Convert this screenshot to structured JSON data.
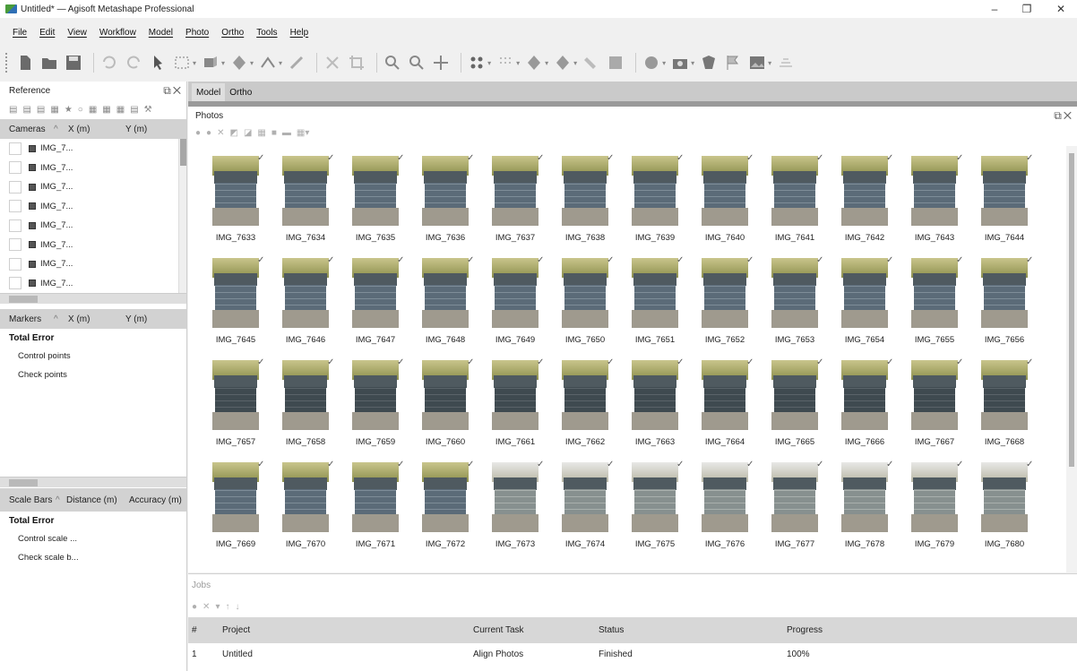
{
  "window": {
    "title": "Untitled* — Agisoft Metashape Professional",
    "buttons": [
      "–",
      "❐",
      "✕"
    ]
  },
  "menu": [
    "File",
    "Edit",
    "View",
    "Workflow",
    "Model",
    "Photo",
    "Ortho",
    "Tools",
    "Help"
  ],
  "toolbar": {
    "icons": [
      "new-icon",
      "open-icon",
      "save-icon",
      "undo-icon",
      "redo-icon",
      "navigation-icon",
      "rectangle-selection-icon",
      "model-icon",
      "dense-cloud-icon",
      "measure-icon",
      "ruler-icon",
      "delete-icon",
      "crop-icon",
      "zoom-in-icon",
      "zoom-out-icon",
      "move-icon",
      "point-cloud-icon",
      "grid-icon",
      "shaded-icon",
      "texture-icon",
      "show-icon",
      "dem-icon",
      "globe-icon",
      "camera-icon",
      "markers-icon",
      "flag-icon",
      "image-icon",
      "align-icon"
    ]
  },
  "reference": {
    "title": "Reference",
    "cameras_header": {
      "col1": "Cameras",
      "col2": "X (m)",
      "col3": "Y (m)"
    },
    "cameras": [
      "IMG_7...",
      "IMG_7...",
      "IMG_7...",
      "IMG_7...",
      "IMG_7...",
      "IMG_7...",
      "IMG_7...",
      "IMG_7..."
    ],
    "markers_header": {
      "col1": "Markers",
      "col2": "X (m)",
      "col3": "Y (m)"
    },
    "markers_total": "Total Error",
    "markers_items": [
      "Control points",
      "Check points"
    ],
    "scalebars_header": {
      "col1": "Scale Bars",
      "col2": "Distance (m)",
      "col3": "Accuracy (m)"
    },
    "scalebars_total": "Total Error",
    "scalebars_items": [
      "Control scale ...",
      "Check scale b..."
    ]
  },
  "tabs": [
    "Model",
    "Ortho"
  ],
  "photos": {
    "title": "Photos",
    "items": [
      "IMG_7633",
      "IMG_7634",
      "IMG_7635",
      "IMG_7636",
      "IMG_7637",
      "IMG_7638",
      "IMG_7639",
      "IMG_7640",
      "IMG_7641",
      "IMG_7642",
      "IMG_7643",
      "IMG_7644",
      "IMG_7645",
      "IMG_7646",
      "IMG_7647",
      "IMG_7648",
      "IMG_7649",
      "IMG_7650",
      "IMG_7651",
      "IMG_7652",
      "IMG_7653",
      "IMG_7654",
      "IMG_7655",
      "IMG_7656",
      "IMG_7657",
      "IMG_7658",
      "IMG_7659",
      "IMG_7660",
      "IMG_7661",
      "IMG_7662",
      "IMG_7663",
      "IMG_7664",
      "IMG_7665",
      "IMG_7666",
      "IMG_7667",
      "IMG_7668",
      "IMG_7669",
      "IMG_7670",
      "IMG_7671",
      "IMG_7672",
      "IMG_7673",
      "IMG_7674",
      "IMG_7675",
      "IMG_7676",
      "IMG_7677",
      "IMG_7678",
      "IMG_7679",
      "IMG_7680"
    ],
    "check": "✓"
  },
  "jobs": {
    "title": "Jobs",
    "columns": [
      "#",
      "Project",
      "Current Task",
      "Status",
      "Progress"
    ],
    "rows": [
      {
        "num": "1",
        "project": "Untitled",
        "task": "Align Photos",
        "status": "Finished",
        "progress": "100%"
      }
    ]
  }
}
